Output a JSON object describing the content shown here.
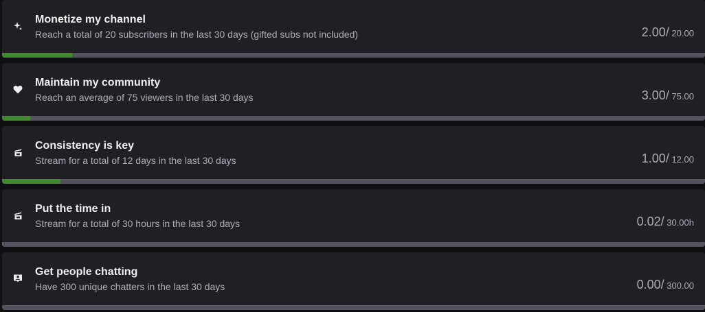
{
  "colors": {
    "card_bg": "#202024",
    "title": "#efeff1",
    "muted": "#adadb8",
    "track": "#53535f",
    "fill": "#3f8b2e"
  },
  "goals": [
    {
      "icon": "sparkle-icon",
      "title": "Monetize my channel",
      "description": "Reach a total of 20 subscribers in the last 30 days (gifted subs not included)",
      "current": "2.00",
      "slash": "/",
      "target": " 20.00",
      "progress": 0.1
    },
    {
      "icon": "heart-icon",
      "title": "Maintain my community",
      "description": "Reach an average of 75 viewers in the last 30 days",
      "current": "3.00",
      "slash": "/",
      "target": " 75.00",
      "progress": 0.04
    },
    {
      "icon": "calendar-icon",
      "title": "Consistency is key",
      "description": "Stream for a total of 12 days in the last 30 days",
      "current": "1.00",
      "slash": "/",
      "target": " 12.00",
      "progress": 0.083
    },
    {
      "icon": "calendar-icon",
      "title": "Put the time in",
      "description": "Stream for a total of 30 hours in the last 30 days",
      "current": "0.02",
      "slash": "/",
      "target": " 30.00h",
      "progress": 0.0007
    },
    {
      "icon": "chat-icon",
      "title": "Get people chatting",
      "description": "Have 300 unique chatters in the last 30 days",
      "current": "0.00",
      "slash": "/",
      "target": " 300.00",
      "progress": 0
    }
  ]
}
